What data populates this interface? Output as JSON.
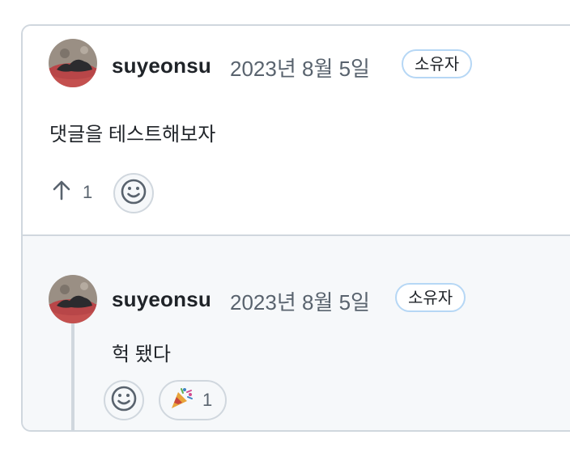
{
  "comment": {
    "author": "suyeonsu",
    "date": "2023년 8월 5일",
    "badge": "소유자",
    "body": "댓글을 테스트해보자",
    "upvote_icon": "arrow-up-icon",
    "upvote_count": "1",
    "reaction_button_icon": "smiley-icon"
  },
  "reply": {
    "author": "suyeonsu",
    "date": "2023년 8월 5일",
    "badge": "소유자",
    "body": "헉 됐다",
    "reaction_button_icon": "smiley-icon",
    "reactions": [
      {
        "icon": "party-popper-icon",
        "emoji": "🎉",
        "count": "1"
      }
    ]
  },
  "colors": {
    "border": "#d0d7de",
    "badge_border": "#b6d7f5",
    "muted_text": "#59636e",
    "reply_background": "#f6f8fa"
  }
}
